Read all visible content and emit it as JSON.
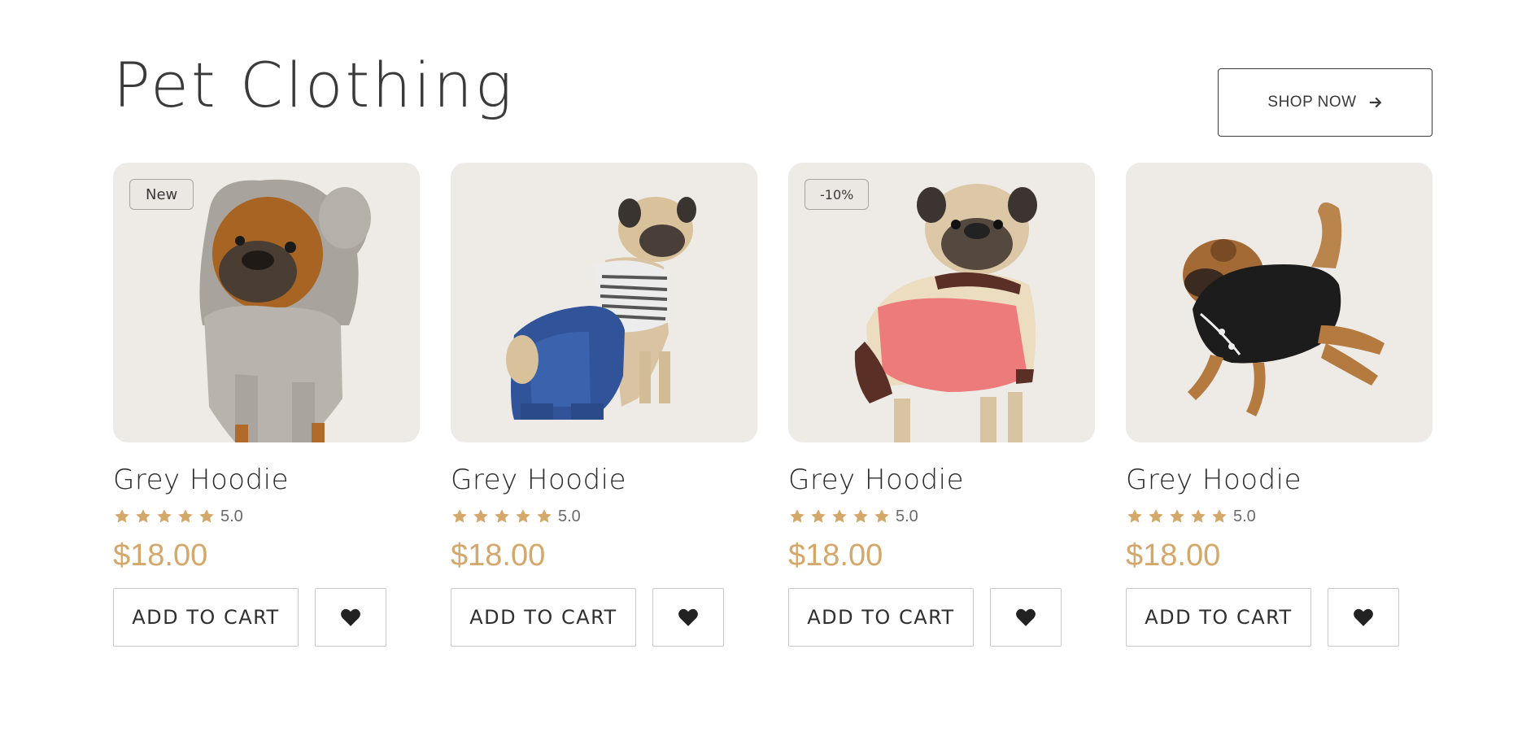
{
  "section": {
    "title": "Pet Clothing",
    "shop_now_label": "SHOP NOW",
    "shop_now_icon": "arrow-right-icon"
  },
  "colors": {
    "accent_price": "#d4a76a",
    "star": "#d4a76a",
    "card_bg": "#eeebe6",
    "text": "#2f2f2f"
  },
  "products": [
    {
      "badge": "New",
      "name": "Grey Hoodie",
      "rating": "5.0",
      "stars": 5,
      "price": "$18.00",
      "add_to_cart": "ADD TO CART",
      "wishlist_icon": "heart-icon",
      "image": "brown dog wearing grey hoodie with ears"
    },
    {
      "badge": "",
      "name": "Grey Hoodie",
      "rating": "5.0",
      "stars": 5,
      "price": "$18.00",
      "add_to_cart": "ADD TO CART",
      "wishlist_icon": "heart-icon",
      "image": "pug in denim overalls and striped shirt"
    },
    {
      "badge": "-10%",
      "name": "Grey Hoodie",
      "rating": "5.0",
      "stars": 5,
      "price": "$18.00",
      "add_to_cart": "ADD TO CART",
      "wishlist_icon": "heart-icon",
      "image": "pug in pink and cream sweater"
    },
    {
      "badge": "",
      "name": "Grey Hoodie",
      "rating": "5.0",
      "stars": 5,
      "price": "$18.00",
      "add_to_cart": "ADD TO CART",
      "wishlist_icon": "heart-icon",
      "image": "brown dog jumping in black shirt"
    }
  ]
}
